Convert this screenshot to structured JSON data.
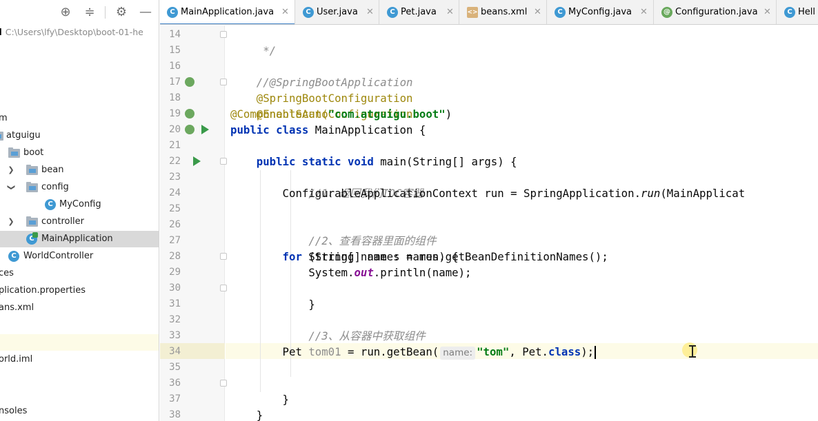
{
  "project": {
    "root_name": "ld",
    "root_path": "C:\\Users\\lfy\\Desktop\\boot-01-he",
    "tree": [
      {
        "label": "m"
      },
      {
        "label": "atguigu"
      },
      {
        "label": "boot"
      },
      {
        "label": "bean"
      },
      {
        "label": "config"
      },
      {
        "label": "MyConfig"
      },
      {
        "label": "controller"
      },
      {
        "label": "MainApplication"
      },
      {
        "label": "WorldController"
      },
      {
        "label": "ces"
      },
      {
        "label": "plication.properties"
      },
      {
        "label": "ans.xml"
      },
      {
        "label": "orld.iml"
      },
      {
        "label": "nsoles"
      }
    ]
  },
  "tabs": [
    {
      "label": "MainApplication.java",
      "icon": "class-run-icon",
      "active": true
    },
    {
      "label": "User.java",
      "icon": "class-icon"
    },
    {
      "label": "Pet.java",
      "icon": "class-icon"
    },
    {
      "label": "beans.xml",
      "icon": "xml-file-icon"
    },
    {
      "label": "MyConfig.java",
      "icon": "class-icon"
    },
    {
      "label": "Configuration.java",
      "icon": "annotation-icon"
    },
    {
      "label": "Hell",
      "icon": "class-icon"
    }
  ],
  "editor": {
    "line_numbers": [
      "14",
      "15",
      "16",
      "17",
      "18",
      "19",
      "20",
      "21",
      "22",
      "23",
      "24",
      "25",
      "26",
      "27",
      "28",
      "29",
      "30",
      "31",
      "32",
      "33",
      "34",
      "35",
      "36",
      "37",
      "38"
    ],
    "code": {
      "l14": " */",
      "l16": "//@SpringBootApplication",
      "l17": "@SpringBootConfiguration",
      "l18": "@EnableAutoConfiguration",
      "l19_anno": "@ComponentScan(",
      "l19_str": "\"com.atguigu.boot\"",
      "l19_end": ")",
      "l20_kw": "public class ",
      "l20_rest": "MainApplication {",
      "l22_kw": "    public static void ",
      "l22_rest": "main(String[] args) {",
      "l23": "        //1、返回我们IOC容器",
      "l24_a": "        ConfigurableApplicationContext run = SpringApplication.",
      "l24_it": "run",
      "l24_b": "(MainApplicat",
      "l26": "        //2、查看容器里面的组件",
      "l27": "        String[] names = run.getBeanDefinitionNames();",
      "l28_kw": "        for ",
      "l28_rest": "(String name : names) {",
      "l29_a": "            System.",
      "l29_fld": "out",
      "l29_b": ".println(name);",
      "l30": "        }",
      "l32": "        //3、从容器中获取组件",
      "l34_a": "        Pet ",
      "l34_var": "tom01",
      "l34_b": " = run.getBean(",
      "l34_hint": "name:",
      "l34_str": "\"tom\"",
      "l34_c": ", Pet.",
      "l34_kw": "class",
      "l34_d": ");",
      "l36": "    }",
      "l37": "}"
    }
  },
  "colors": {
    "keyword": "#0033b3",
    "comment": "#8c8c8c",
    "annotation": "#9e880d",
    "string": "#067d17",
    "selection": "#d9d9d9",
    "caret_line": "#fdfbe7",
    "tab_underline": "#4083c9"
  }
}
